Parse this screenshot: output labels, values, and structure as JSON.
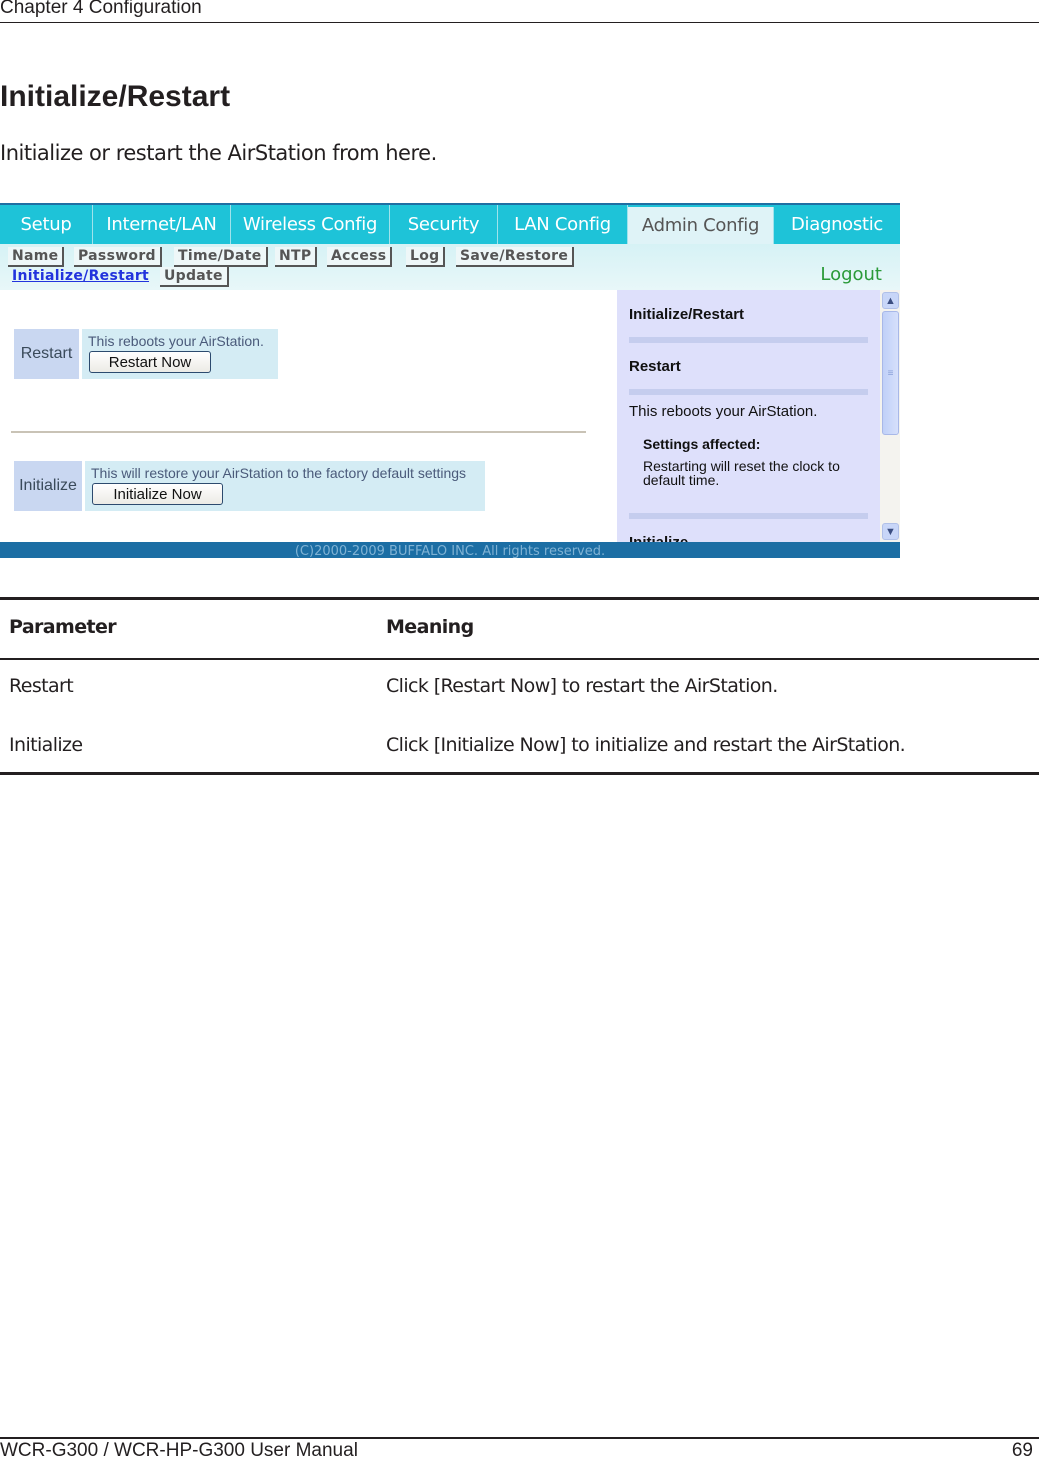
{
  "header": {
    "chapter": "Chapter 4  Configuration"
  },
  "page": {
    "title": "Initialize/Restart",
    "intro": "Initialize or restart the AirStation from here."
  },
  "router_ui": {
    "tabs": [
      {
        "label": "Setup",
        "active": false
      },
      {
        "label": "Internet/LAN",
        "active": false
      },
      {
        "label": "Wireless Config",
        "active": false
      },
      {
        "label": "Security",
        "active": false
      },
      {
        "label": "LAN Config",
        "active": false
      },
      {
        "label": "Admin Config",
        "active": true
      },
      {
        "label": "Diagnostic",
        "active": false
      }
    ],
    "subtabs": [
      {
        "label": "Name"
      },
      {
        "label": "Password"
      },
      {
        "label": "Time/Date"
      },
      {
        "label": "NTP"
      },
      {
        "label": "Access"
      },
      {
        "label": "Log"
      },
      {
        "label": "Save/Restore"
      },
      {
        "label": "Initialize/Restart",
        "active": true
      },
      {
        "label": "Update"
      }
    ],
    "logout": "Logout",
    "sections": {
      "restart": {
        "label": "Restart",
        "description": "This reboots your AirStation.",
        "button": "Restart Now"
      },
      "initialize": {
        "label": "Initialize",
        "description": "This will restore your AirStation to the factory default settings",
        "button": "Initialize Now"
      }
    },
    "help": {
      "title": "Initialize/Restart",
      "restart_heading": "Restart",
      "restart_text": "This reboots your AirStation.",
      "settings_heading": "Settings affected:",
      "settings_text_1": "Restarting will reset the clock to",
      "settings_text_2": "default time.",
      "next_heading": "Initialize"
    },
    "scrollbar": {
      "up_icon": "▲",
      "down_icon": "▼",
      "grip_icon": "≡"
    },
    "copyright": "(C)2000-2009 BUFFALO INC. All rights reserved.",
    "colors": {
      "tab_bg": "#1ec3d8",
      "footer_bg": "#1c6ea4",
      "help_bg": "#dee0fb",
      "logout": "#2a9a38"
    }
  },
  "table": {
    "headers": [
      "Parameter",
      "Meaning"
    ],
    "rows": [
      [
        "Restart",
        "Click [Restart Now] to restart the AirStation."
      ],
      [
        "Initialize",
        "Click [Initialize Now] to initialize and restart the AirStation."
      ]
    ]
  },
  "footer": {
    "manual": "WCR-G300 / WCR-HP-G300 User Manual",
    "page_number": "69"
  }
}
